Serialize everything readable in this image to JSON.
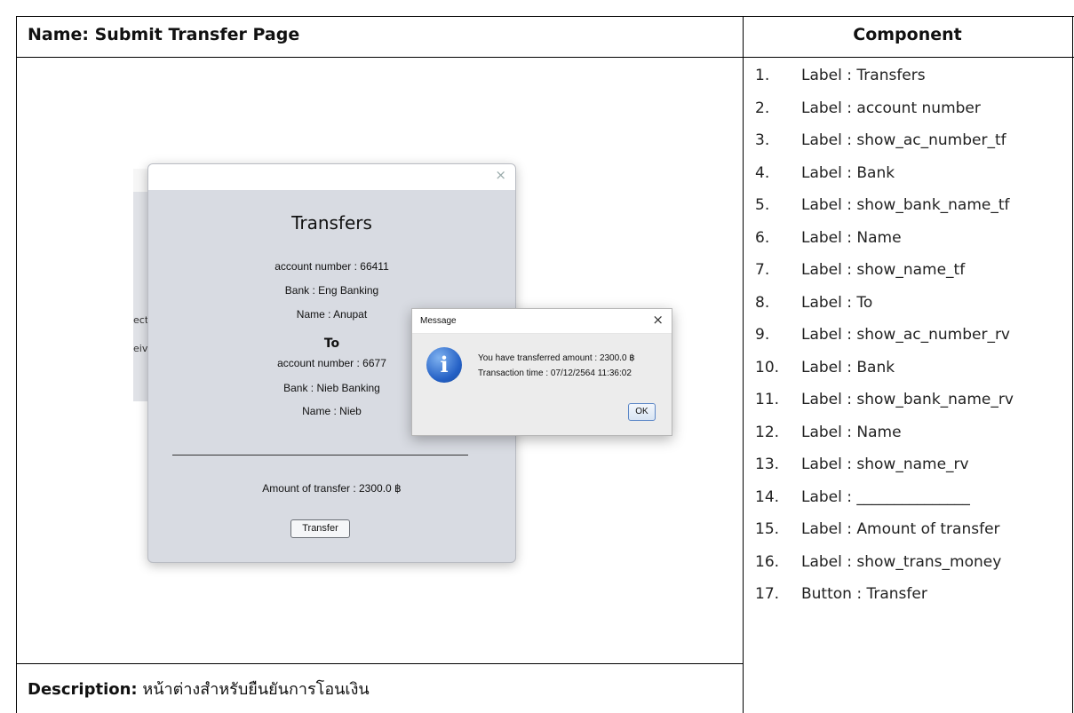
{
  "header": {
    "name_label": "Name: Submit Transfer Page",
    "component_label": "Component"
  },
  "description": {
    "label": "Description:",
    "text": "หน้าต่างสำหรับยืนยันการโอนเงิน"
  },
  "components": [
    {
      "num": "1.",
      "text": "Label : Transfers"
    },
    {
      "num": "2.",
      "text": "Label : account number"
    },
    {
      "num": "3.",
      "text": "Label : show_ac_number_tf"
    },
    {
      "num": "4.",
      "text": "Label : Bank"
    },
    {
      "num": "5.",
      "text": "Label : show_bank_name_tf"
    },
    {
      "num": "6.",
      "text": "Label : Name"
    },
    {
      "num": "7.",
      "text": "Label : show_name_tf"
    },
    {
      "num": "8.",
      "text": "Label : To"
    },
    {
      "num": "9.",
      "text": "Label : show_ac_number_rv"
    },
    {
      "num": "10.",
      "text": "Label : Bank"
    },
    {
      "num": "11.",
      "text": "Label : show_bank_name_rv"
    },
    {
      "num": "12.",
      "text": "Label : Name"
    },
    {
      "num": "13.",
      "text": "Label : show_name_rv"
    },
    {
      "num": "14.",
      "text": "Label : _______________"
    },
    {
      "num": "15.",
      "text": "Label : Amount of transfer"
    },
    {
      "num": "16.",
      "text": "Label : show_trans_money"
    },
    {
      "num": "17.",
      "text": "Button : Transfer"
    }
  ],
  "screenshot": {
    "bg_fragments": [
      "ect",
      "eiv"
    ],
    "main": {
      "close": "×",
      "title": "Transfers",
      "sender_account": "account number :  66411",
      "sender_bank": "Bank :  Eng Banking",
      "sender_name": "Name :  Anupat",
      "to": "To",
      "receiver_account": "account number :  6677",
      "receiver_bank": "Bank :  Nieb Banking",
      "receiver_name": "Name :  Nieb",
      "amount": "Amount of transfer : 2300.0 ฿",
      "button": "Transfer"
    },
    "message": {
      "title": "Message",
      "close": "×",
      "icon": "i",
      "line1": "You have transferred amount : 2300.0 ฿",
      "line2": "Transaction time : 07/12/2564 11:36:02",
      "ok": "OK"
    }
  }
}
